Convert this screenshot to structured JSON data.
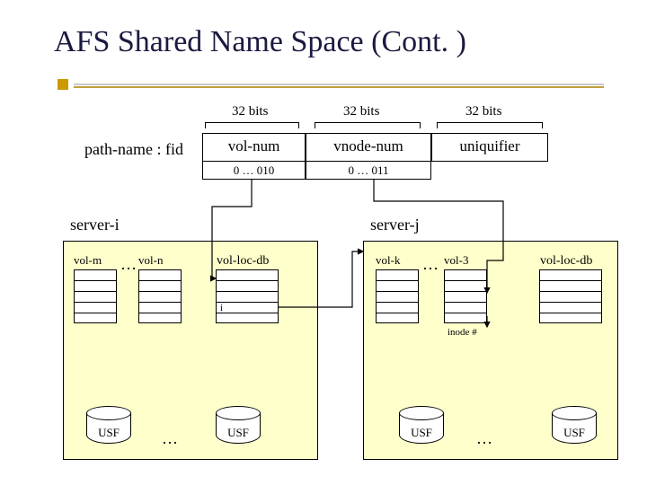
{
  "title": "AFS Shared Name Space (Cont. )",
  "fid": {
    "bits32_labels": [
      "32 bits",
      "32 bits",
      "32 bits"
    ],
    "path_label": "path-name : fid",
    "cells": [
      "vol-num",
      "vnode-num",
      "uniquifier"
    ],
    "subcells": [
      "0 … 010",
      "0 … 011"
    ]
  },
  "servers": {
    "i": {
      "label": "server-i",
      "vol_labels": [
        "vol-m",
        "vol-n"
      ],
      "dots_between": "…",
      "vldb_label": "vol-loc-db",
      "vldb_rows": [
        "",
        "",
        "",
        "i",
        ""
      ],
      "usf_label": "USF",
      "dots_bottom": "…"
    },
    "j": {
      "label": "server-j",
      "vol_labels": [
        "vol-k",
        "vol-3"
      ],
      "dots_between": "…",
      "vldb_label": "vol-loc-db",
      "vldb_rows": [
        "",
        "",
        "",
        "",
        ""
      ],
      "inode_label": "inode #",
      "usf_label": "USF",
      "dots_bottom": "…"
    }
  }
}
